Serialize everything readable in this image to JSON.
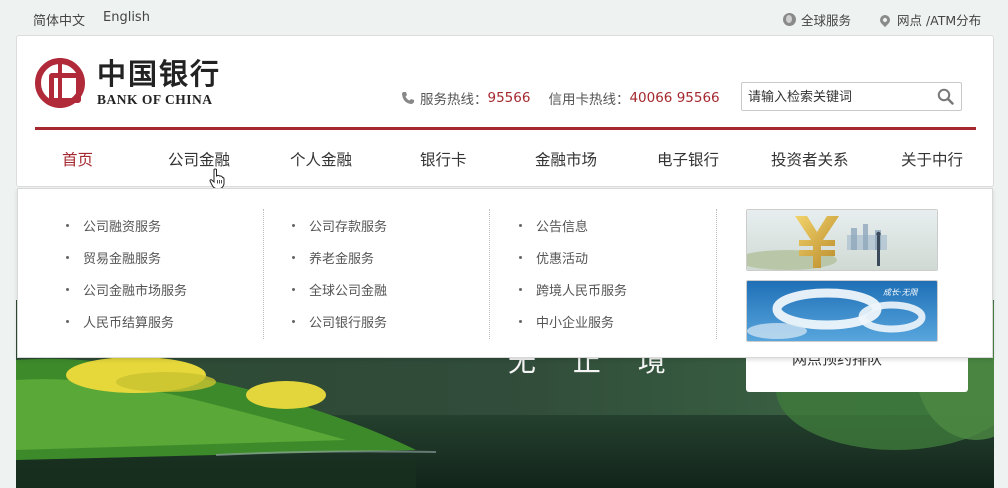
{
  "topbar": {
    "lang_cn": "简体中文",
    "lang_en": "English",
    "global_services": "全球服务",
    "branches_atm": "网点 /ATM分布"
  },
  "brand": {
    "name_cn": "中国银行",
    "name_en": "BANK OF CHINA",
    "color": "#a5282f"
  },
  "hotlines": {
    "service_label": "服务热线：",
    "service_number": "95566",
    "card_label": "信用卡热线：",
    "card_number": "40066 95566"
  },
  "search": {
    "placeholder": "请输入检索关键词"
  },
  "nav": {
    "items": [
      {
        "label": "首页"
      },
      {
        "label": "公司金融"
      },
      {
        "label": "个人金融"
      },
      {
        "label": "银行卡"
      },
      {
        "label": "金融市场"
      },
      {
        "label": "电子银行"
      },
      {
        "label": "投资者关系"
      },
      {
        "label": "关于中行"
      }
    ],
    "active": "首页",
    "hovered": "公司金融"
  },
  "dropdown": {
    "columns": [
      [
        "公司融资服务",
        "贸易金融服务",
        "公司金融市场服务",
        "人民币结算服务"
      ],
      [
        "公司存款服务",
        "养老金服务",
        "全球公司金融",
        "公司银行服务"
      ],
      [
        "公告信息",
        "优惠活动",
        "跨境人民币服务",
        "中小企业服务"
      ]
    ],
    "promo_2_text": "成长·无限"
  },
  "hero": {
    "caption": "无 止 境",
    "side_card_text": "网点预约排队"
  }
}
